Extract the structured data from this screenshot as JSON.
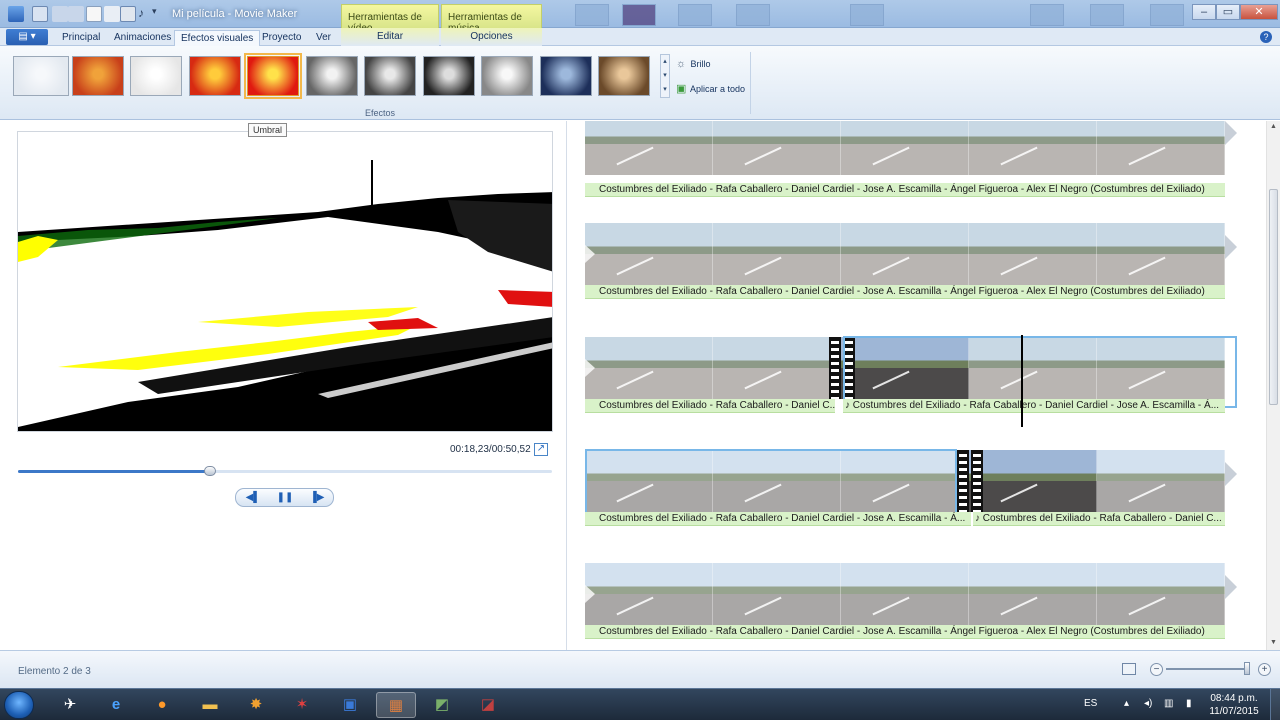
{
  "window": {
    "title": "Mi película - Movie Maker",
    "context_tabs": [
      "Herramientas de vídeo",
      "Herramientas de música"
    ]
  },
  "tabs": [
    "Principal",
    "Animaciones",
    "Efectos visuales",
    "Proyecto",
    "Ver"
  ],
  "active_tab": "Efectos visuales",
  "context_groups": [
    "Editar",
    "Opciones"
  ],
  "ribbon": {
    "group_label": "Efectos",
    "brightness_label": "Brillo",
    "apply_all_label": "Aplicar a todo",
    "tooltip": "Umbral",
    "effects": [
      {
        "name": "none",
        "colors": [
          "#f6f8fb",
          "#e3e9f0"
        ]
      },
      {
        "name": "warm",
        "colors": [
          "#f0a23a",
          "#c8401a"
        ]
      },
      {
        "name": "blur",
        "colors": [
          "#ffffff",
          "#e6e6e6"
        ]
      },
      {
        "name": "posterize",
        "colors": [
          "#ffcb3b",
          "#d72a12"
        ]
      },
      {
        "name": "threshold",
        "colors": [
          "#ffe24a",
          "#e01a10"
        ],
        "selected": true
      },
      {
        "name": "gray1",
        "colors": [
          "#f2f2f2",
          "#666666"
        ]
      },
      {
        "name": "gray2",
        "colors": [
          "#e8e8e8",
          "#444444"
        ]
      },
      {
        "name": "gray3",
        "colors": [
          "#dddddd",
          "#222222"
        ]
      },
      {
        "name": "gray4",
        "colors": [
          "#f8f8f8",
          "#888888"
        ]
      },
      {
        "name": "cyanotype",
        "colors": [
          "#9db8dc",
          "#1d2f5a"
        ]
      },
      {
        "name": "sepia",
        "colors": [
          "#e9c79a",
          "#6b4a2a"
        ]
      }
    ]
  },
  "player": {
    "timecode": "00:18,23/00:50,52",
    "progress": 0.36
  },
  "storyboard": {
    "rows": [
      {
        "caption": "Costumbres del Exiliado - Rafa Caballero - Daniel Cardiel - Jose A. Escamilla - Ángel Figueroa - Alex El Negro (Costumbres del Exiliado)"
      },
      {
        "caption": "Costumbres del Exiliado - Rafa Caballero - Daniel Cardiel - Jose A. Escamilla - Ángel Figueroa - Alex El Negro (Costumbres del Exiliado)"
      },
      {
        "caption_a": "Costumbres del Exiliado - Rafa Caballero - Daniel C...",
        "caption_b": "♪ Costumbres del Exiliado - Rafa Caballero - Daniel Cardiel - Jose A. Escamilla - Á..."
      },
      {
        "caption_a": "Costumbres del Exiliado - Rafa Caballero - Daniel Cardiel - Jose A. Escamilla - Á...",
        "caption_b": "♪ Costumbres del Exiliado - Rafa Caballero - Daniel C..."
      },
      {
        "caption": "Costumbres del Exiliado - Rafa Caballero - Daniel Cardiel - Jose A. Escamilla - Ángel Figueroa - Alex El Negro (Costumbres del Exiliado)"
      }
    ]
  },
  "status": {
    "text": "Elemento 2 de 3",
    "zoom": 0.98
  },
  "taskbar": {
    "lang": "ES",
    "time": "08:44 p.m.",
    "date": "11/07/2015"
  }
}
